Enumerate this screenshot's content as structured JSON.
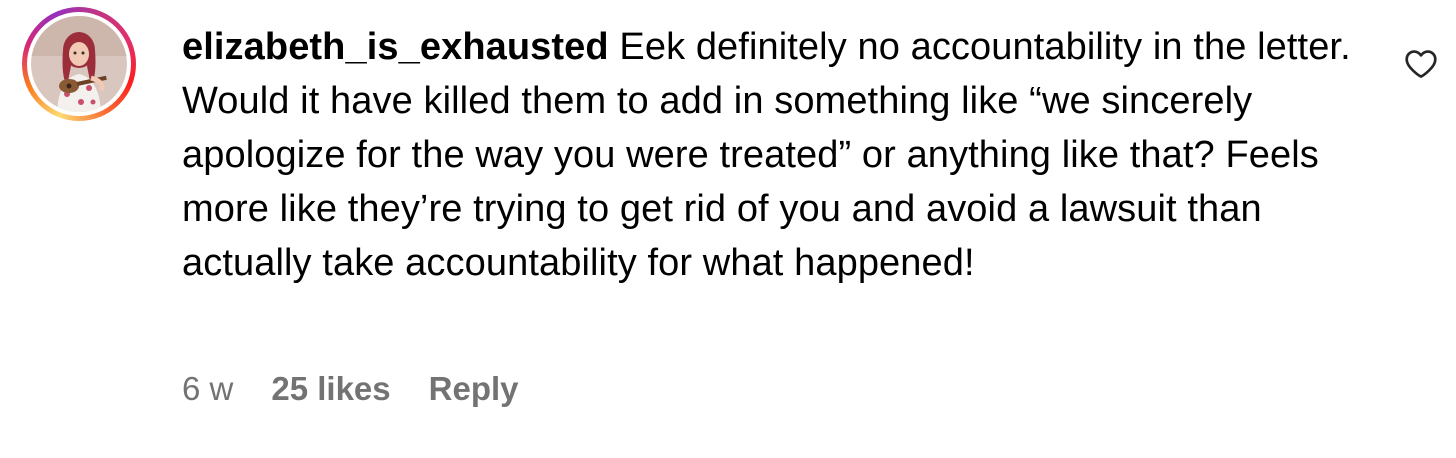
{
  "comment": {
    "username": "elizabeth_is_exhausted",
    "text": "Eek definitely no accountability in the letter. Would it have killed them to add in something like “we sincerely apologize for the way you were treated” or anything like that? Feels more like they’re trying to get rid of you and avoid a lawsuit than actually take accountability for what happened!",
    "time": "6 w",
    "likes": "25 likes",
    "reply_label": "Reply",
    "like_icon": "heart-outline-icon"
  },
  "colors": {
    "meta_text": "#737373",
    "text": "#000000",
    "background": "#ffffff"
  }
}
